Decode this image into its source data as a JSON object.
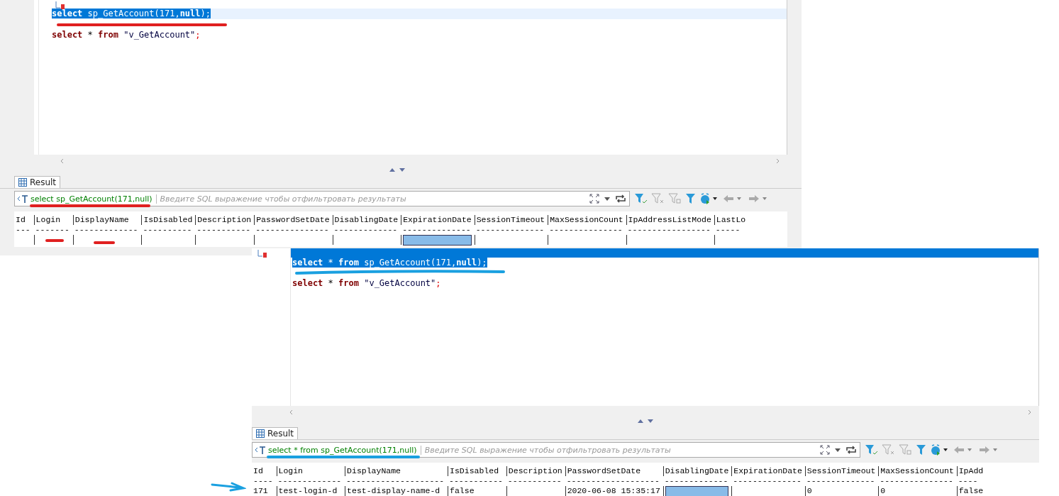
{
  "panels": [
    {
      "editor": {
        "lines": [
          {
            "selected": true,
            "tokens": [
              {
                "kind": "keyword",
                "text": "select"
              },
              {
                "kind": "plain",
                "text": " sp_GetAccount(171,"
              },
              {
                "kind": "keyword",
                "text": "null"
              },
              {
                "kind": "plain",
                "text": ");"
              }
            ]
          },
          {
            "selected": false,
            "tokens": [
              {
                "kind": "keyword",
                "text": "select"
              },
              {
                "kind": "plain",
                "text": " * "
              },
              {
                "kind": "keyword",
                "text": "from"
              },
              {
                "kind": "string",
                "text": " \"v_GetAccount\""
              },
              {
                "kind": "punct",
                "text": ";"
              }
            ]
          }
        ]
      },
      "result_tab": {
        "label": "Result",
        "selected": true
      },
      "filter": {
        "query": "select sp_GetAccount(171,null)",
        "placeholder": "Введите SQL выражение чтобы отфильтровать результаты"
      },
      "grid": {
        "columns": [
          {
            "header": "Id",
            "rule": "---"
          },
          {
            "header": "Login",
            "rule": "-------"
          },
          {
            "header": "DisplayName",
            "rule": "-------------"
          },
          {
            "header": "IsDisabled",
            "rule": "----------"
          },
          {
            "header": "Description",
            "rule": "-----------"
          },
          {
            "header": "PasswordSetDate",
            "rule": "---------------"
          },
          {
            "header": "DisablingDate",
            "rule": "-------------"
          },
          {
            "header": "ExpirationDate",
            "rule": "--------------"
          },
          {
            "header": "SessionTimeout",
            "rule": "--------------"
          },
          {
            "header": "MaxSessionCount",
            "rule": "---------------"
          },
          {
            "header": "IpAddressListMode",
            "rule": "-----------------"
          },
          {
            "header": "LastLo",
            "rule": "-----"
          }
        ],
        "rows": [
          {
            "cells": [
              {
                "selected": false
              },
              {
                "selected": false
              },
              {
                "selected": false
              },
              {
                "selected": false
              },
              {
                "selected": false
              },
              {
                "selected": false
              },
              {
                "selected": false
              },
              {
                "selected": true
              },
              {
                "selected": false
              },
              {
                "selected": false
              },
              {
                "selected": false
              },
              {
                "selected": false
              }
            ]
          }
        ]
      }
    },
    {
      "editor": {
        "lines": [
          {
            "selected": true
          },
          {
            "selected": true,
            "tokens": [
              {
                "kind": "keyword",
                "text": "select"
              },
              {
                "kind": "plain",
                "text": " * "
              },
              {
                "kind": "keyword",
                "text": "from"
              },
              {
                "kind": "plain",
                "text": " sp_GetAccount(171,"
              },
              {
                "kind": "keyword",
                "text": "null"
              },
              {
                "kind": "plain",
                "text": ");"
              }
            ]
          },
          {
            "selected": false,
            "tokens": [
              {
                "kind": "keyword",
                "text": "select"
              },
              {
                "kind": "plain",
                "text": " * "
              },
              {
                "kind": "keyword",
                "text": "from"
              },
              {
                "kind": "string",
                "text": " \"v_GetAccount\""
              },
              {
                "kind": "punct",
                "text": ";"
              }
            ]
          }
        ]
      },
      "result_tab": {
        "label": "Result",
        "selected": true
      },
      "filter": {
        "query": "select * from sp_GetAccount(171,null)",
        "placeholder": "Введите SQL выражение чтобы отфильтровать результаты"
      },
      "grid": {
        "columns": [
          {
            "header": "Id",
            "rule": "----"
          },
          {
            "header": "Login",
            "rule": "-------------"
          },
          {
            "header": "DisplayName",
            "rule": "--------------------"
          },
          {
            "header": "IsDisabled",
            "rule": "-----------"
          },
          {
            "header": "Description",
            "rule": "-----------"
          },
          {
            "header": "PasswordSetDate",
            "rule": "-------------------"
          },
          {
            "header": "DisablingDate",
            "rule": "-------------"
          },
          {
            "header": "ExpirationDate",
            "rule": "--------------"
          },
          {
            "header": "SessionTimeout",
            "rule": "--------------"
          },
          {
            "header": "MaxSessionCount",
            "rule": "---------------"
          },
          {
            "header": "IpAdd",
            "rule": "----"
          }
        ],
        "rows": [
          {
            "cells": [
              {
                "value": "171",
                "selected": false
              },
              {
                "value": "test-login-d",
                "selected": false
              },
              {
                "value": "test-display-name-d",
                "selected": false
              },
              {
                "value": "false",
                "selected": false
              },
              {
                "selected": false
              },
              {
                "value": "2020-06-08 15:35:17",
                "selected": false
              },
              {
                "selected": true
              },
              {
                "selected": false
              },
              {
                "value": "0",
                "selected": false
              },
              {
                "value": "0",
                "selected": false
              },
              {
                "value": "false",
                "selected": false
              }
            ]
          }
        ]
      }
    }
  ]
}
